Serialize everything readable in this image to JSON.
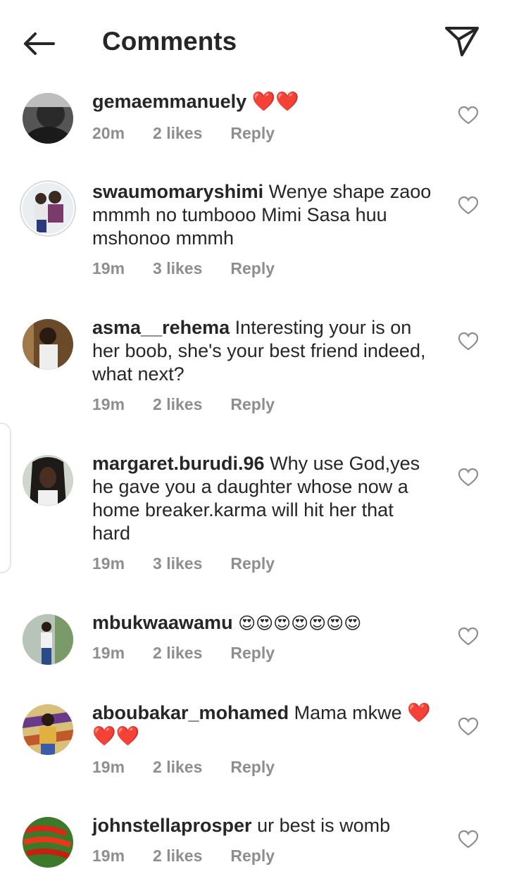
{
  "header": {
    "title": "Comments",
    "back_icon": "arrow-left-icon",
    "share_icon": "paper-plane-icon"
  },
  "comments": [
    {
      "username": "gemaemmanuely",
      "text": "❤️❤️",
      "time": "20m",
      "likes": "2 likes",
      "reply": "Reply"
    },
    {
      "username": "swaumomaryshimi",
      "text": "Wenye shape zaoo mmmh no tumbooo Mimi Sasa huu mshonoo mmmh",
      "time": "19m",
      "likes": "3 likes",
      "reply": "Reply"
    },
    {
      "username": "asma__rehema",
      "text": "Interesting your is on her boob, she's your best friend indeed, what next?",
      "time": "19m",
      "likes": "2 likes",
      "reply": "Reply"
    },
    {
      "username": "margaret.burudi.96",
      "text": "Why use God,yes he gave you a daughter whose now a home breaker.karma will hit her that hard",
      "time": "19m",
      "likes": "3 likes",
      "reply": "Reply"
    },
    {
      "username": "mbukwaawamu",
      "text": "😍😍😍😍😍😍😍",
      "time": "19m",
      "likes": "2 likes",
      "reply": "Reply"
    },
    {
      "username": "aboubakar_mohamed",
      "text": "Mama mkwe ❤️❤️❤️",
      "time": "19m",
      "likes": "2 likes",
      "reply": "Reply"
    },
    {
      "username": "johnstellaprosper",
      "text": "ur best is womb",
      "time": "19m",
      "likes": "2 likes",
      "reply": "Reply"
    }
  ],
  "colors": {
    "text": "#262626",
    "meta": "#8e8e8e",
    "heart_emoji": "#e0202e",
    "background": "#ffffff"
  }
}
